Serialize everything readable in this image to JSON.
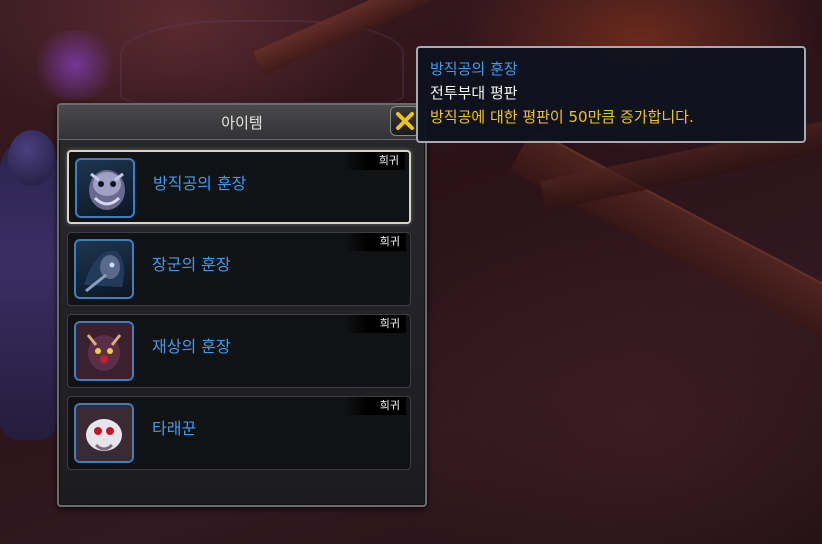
{
  "panel": {
    "title": "아이템",
    "items": [
      {
        "name": "방직공의 훈장",
        "badge": "희귀",
        "icon": "tuskarr-portrait-icon",
        "selected": true
      },
      {
        "name": "장군의 훈장",
        "badge": "희귀",
        "icon": "hooded-warrior-portrait-icon",
        "selected": false
      },
      {
        "name": "재상의 훈장",
        "badge": "희귀",
        "icon": "spider-lord-portrait-icon",
        "selected": false
      },
      {
        "name": "타래꾼",
        "badge": "희귀",
        "icon": "white-spider-portrait-icon",
        "selected": false
      }
    ]
  },
  "tooltip": {
    "title": "방직공의 훈장",
    "subtitle": "전투부대 평판",
    "description": "방직공에 대한 평판이 50만큼 증가합니다."
  },
  "colors": {
    "item_name": "#3e9cf0",
    "description": "#f0c418",
    "close_icon": "#f2c21a"
  }
}
